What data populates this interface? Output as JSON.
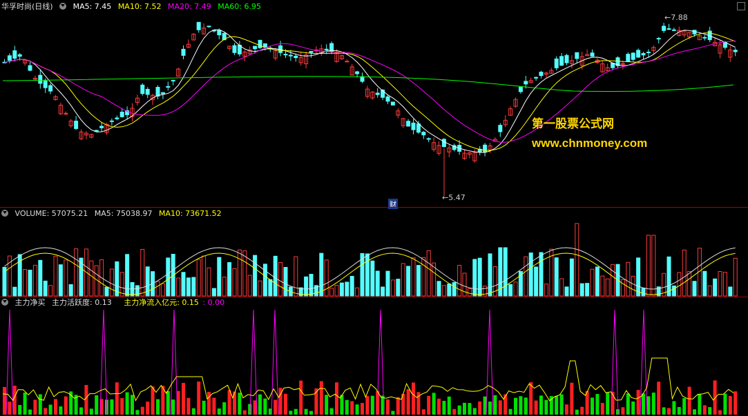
{
  "main": {
    "title": "华孚时尚(日线)",
    "ma5": "MA5: 7.45",
    "ma10": "MA10: 7.52",
    "ma20": "MA20: 7.49",
    "ma60": "MA60: 6.95",
    "high_label": "7.88",
    "low_label": "5.47",
    "cai_label": "财",
    "watermark1": "第一股票公式网",
    "watermark2": "www.chnmoney.com"
  },
  "volume": {
    "vol": "VOLUME: 57075.21",
    "ma5": "MA5: 75038.97",
    "ma10": "MA10: 73671.52"
  },
  "indicator": {
    "name": "主力净买",
    "activity": "主力活跃度: 0.13",
    "inflow": "主力净流入亿元: 0.15",
    "extra": ": 0.00"
  },
  "colors": {
    "up": "#ff3c3c",
    "down": "#54fcfc",
    "ma5": "#ffffff",
    "ma10": "#ffff00",
    "ma20": "#ff00ff",
    "ma60": "#00ff00",
    "green_bar": "#00e000",
    "red_bar": "#ff2020"
  }
}
